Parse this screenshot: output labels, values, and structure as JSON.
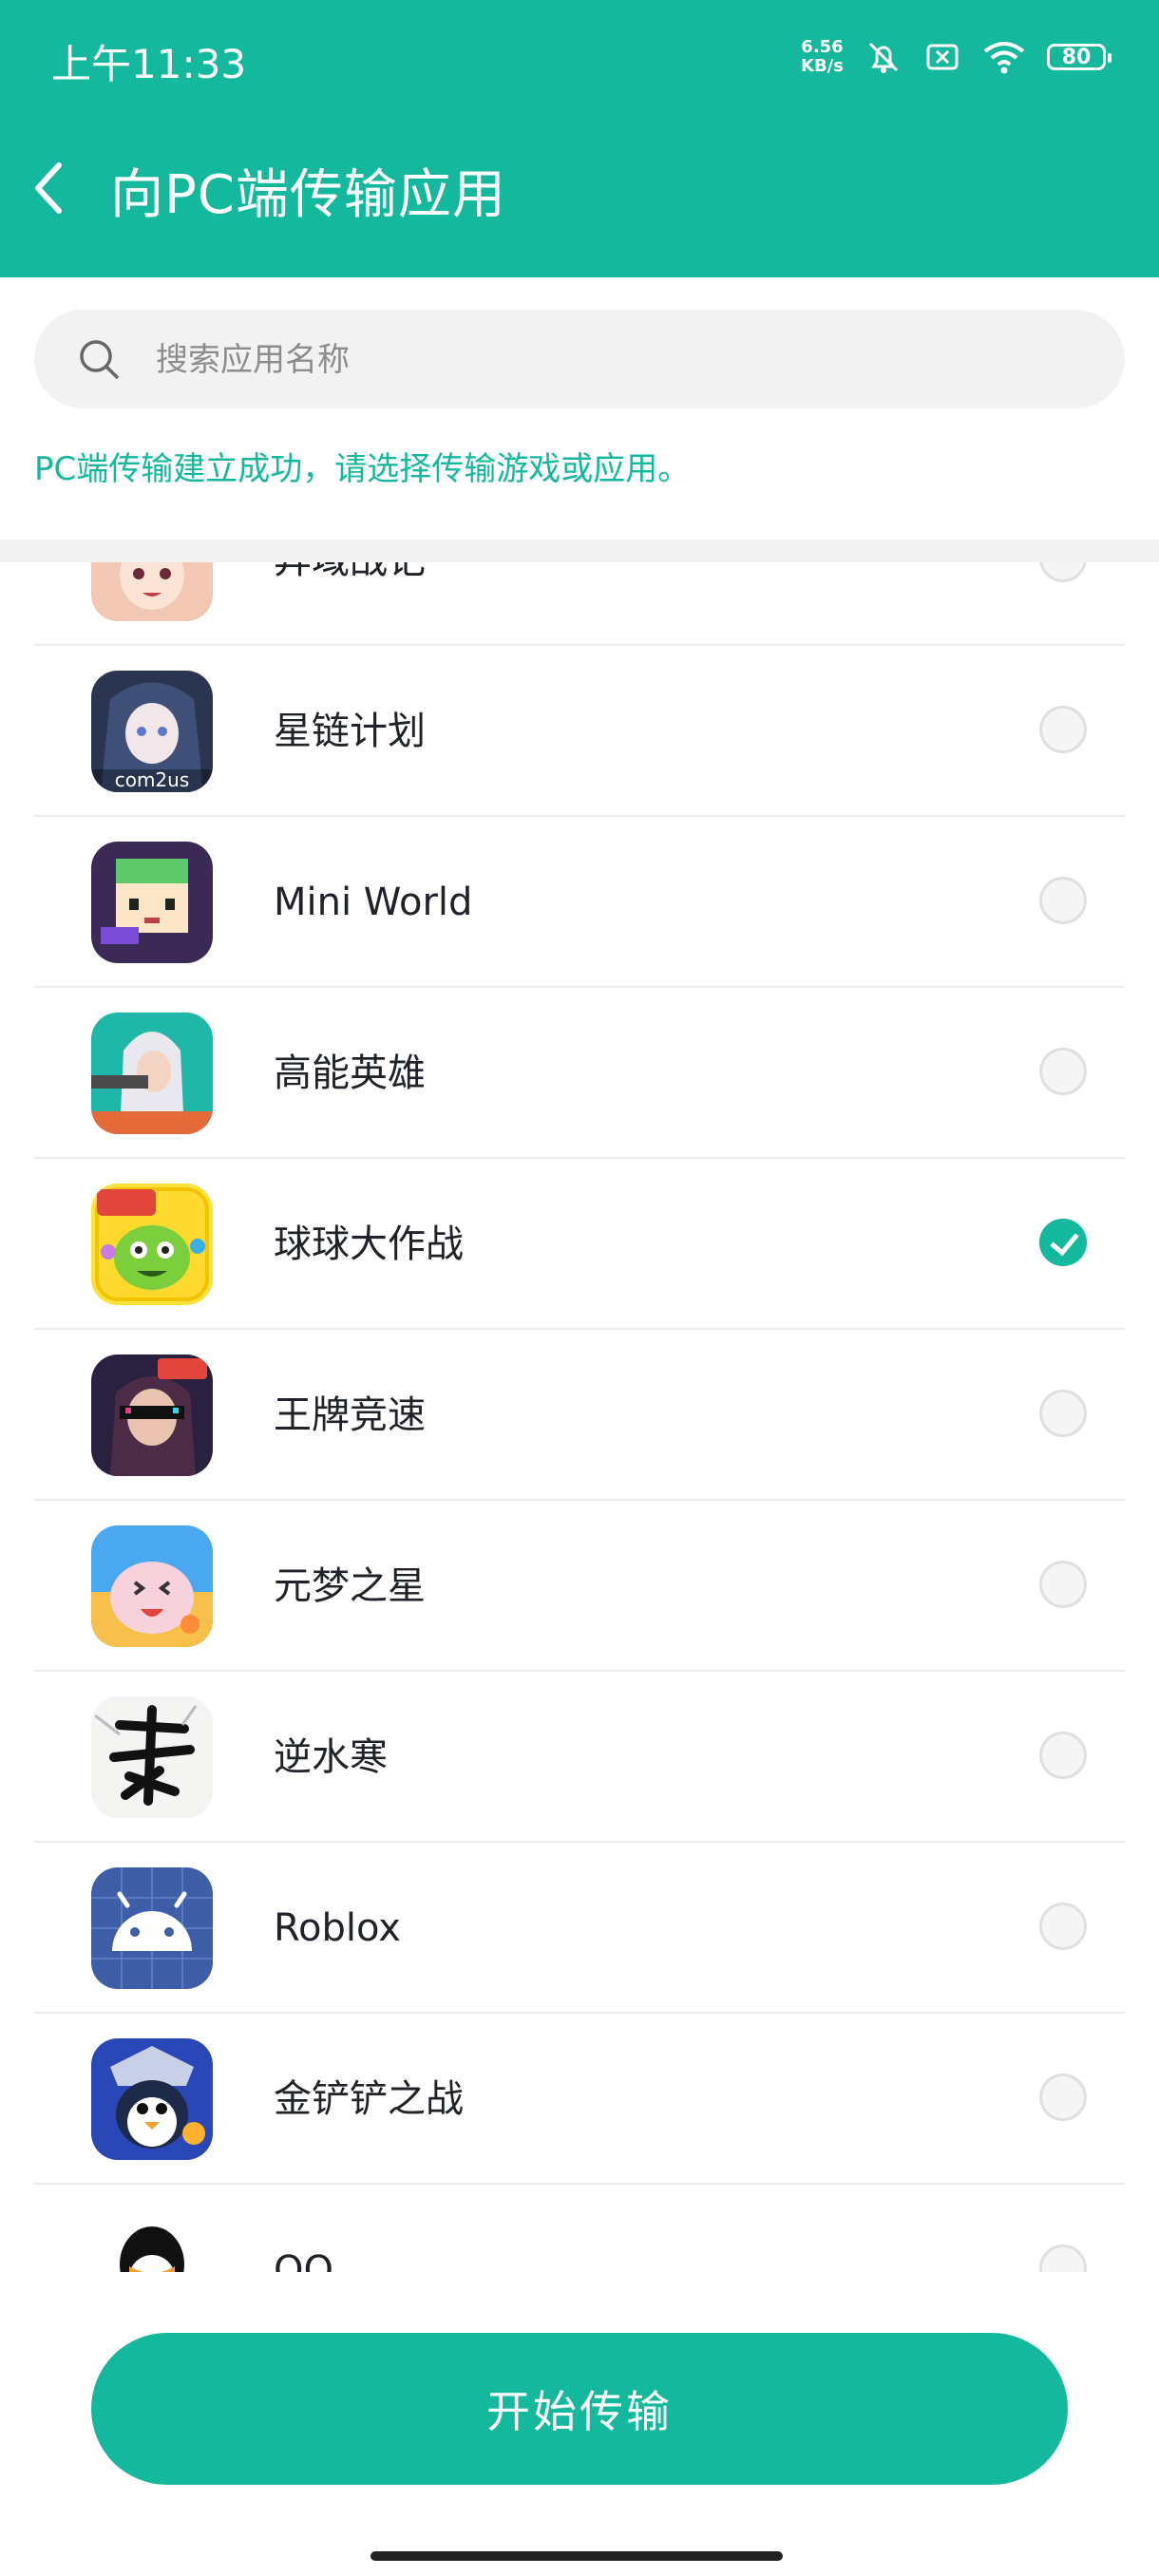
{
  "status_bar": {
    "time": "上午11:33",
    "net_speed_value": "6.56",
    "net_speed_unit": "KB/s",
    "battery": "80"
  },
  "header": {
    "title": "向PC端传输应用"
  },
  "search": {
    "placeholder": "搜索应用名称"
  },
  "hint_text": "PC端传输建立成功，请选择传输游戏或应用。",
  "apps": [
    {
      "name": "异域战记",
      "icon": "anime-girl-icon",
      "selected": false
    },
    {
      "name": "星链计划",
      "icon": "anime-girl-icon",
      "selected": false
    },
    {
      "name": "Mini World",
      "icon": "block-character-icon",
      "selected": false
    },
    {
      "name": "高能英雄",
      "icon": "hooded-hero-icon",
      "selected": false
    },
    {
      "name": "球球大作战",
      "icon": "green-blob-icon",
      "selected": true
    },
    {
      "name": "王牌竞速",
      "icon": "racer-icon",
      "selected": false
    },
    {
      "name": "元梦之星",
      "icon": "pink-cat-icon",
      "selected": false
    },
    {
      "name": "逆水寒",
      "icon": "calligraphy-icon",
      "selected": false
    },
    {
      "name": "Roblox",
      "icon": "android-icon",
      "selected": false
    },
    {
      "name": "金铲铲之战",
      "icon": "penguin-icon",
      "selected": false
    },
    {
      "name": "QQ",
      "icon": "qq-penguin-icon",
      "selected": false
    }
  ],
  "start_button_label": "开始传输",
  "colors": {
    "accent": "#14b89c",
    "search_bg": "#f2f2f2"
  }
}
